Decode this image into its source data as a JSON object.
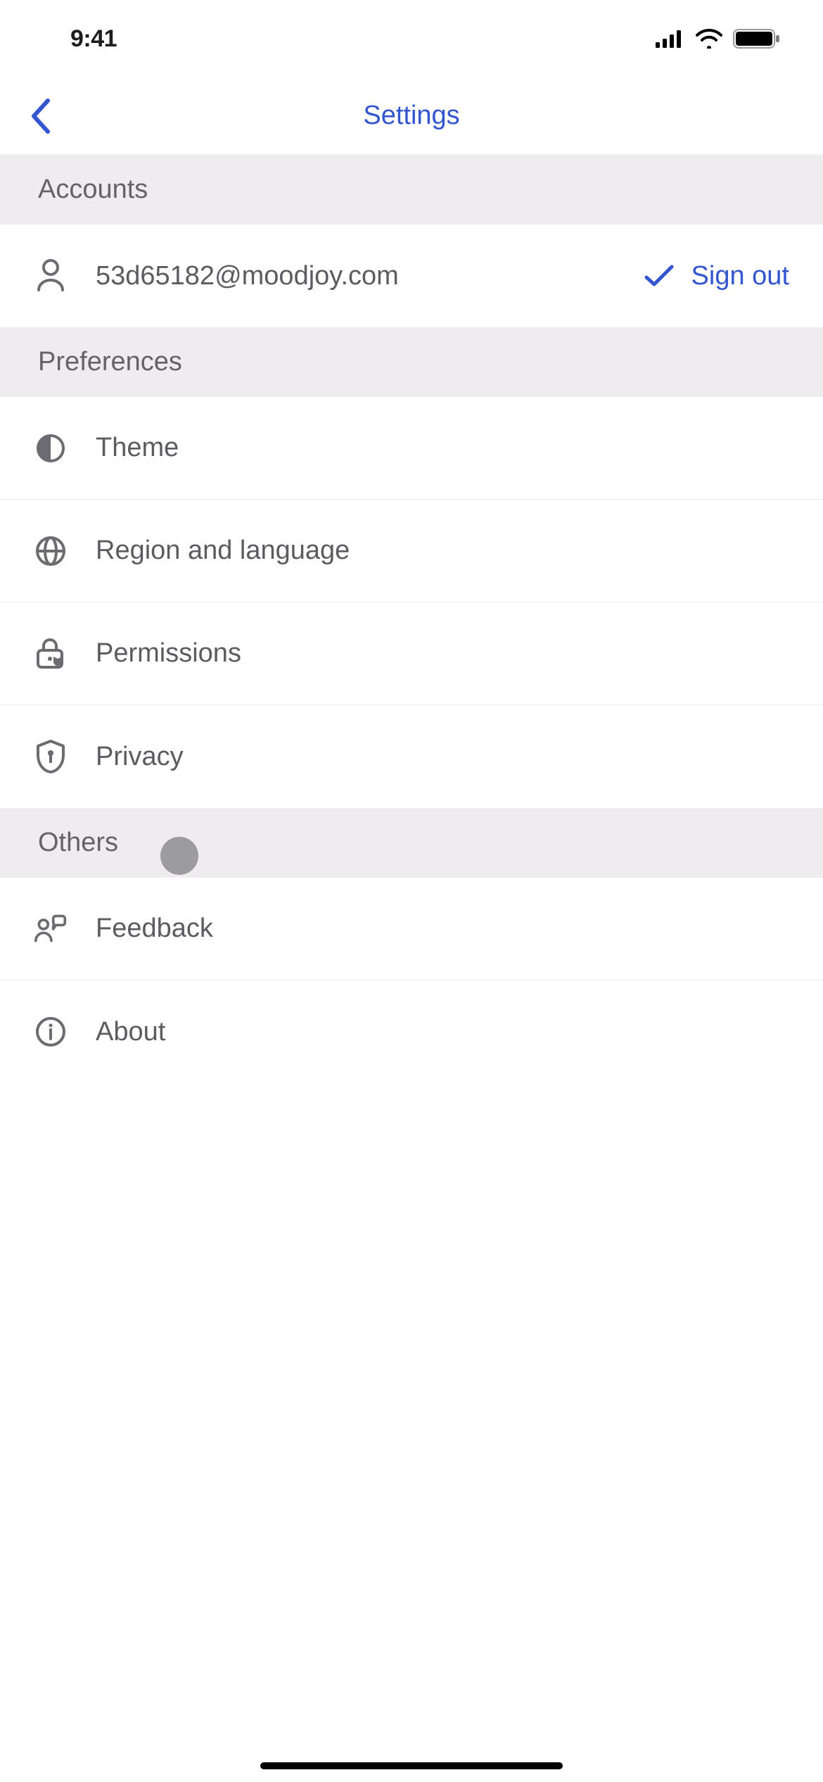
{
  "status": {
    "time": "9:41"
  },
  "nav": {
    "title": "Settings"
  },
  "sections": {
    "accounts": {
      "label": "Accounts",
      "email": "53d65182@moodjoy.com",
      "sign_out": "Sign out"
    },
    "preferences": {
      "label": "Preferences",
      "items": [
        {
          "icon": "half-circle",
          "label": "Theme"
        },
        {
          "icon": "globe",
          "label": "Region and language"
        },
        {
          "icon": "lock-shield",
          "label": "Permissions"
        },
        {
          "icon": "shield-key",
          "label": "Privacy"
        }
      ]
    },
    "others": {
      "label": "Others",
      "items": [
        {
          "icon": "feedback",
          "label": "Feedback"
        },
        {
          "icon": "info",
          "label": "About"
        }
      ]
    }
  }
}
